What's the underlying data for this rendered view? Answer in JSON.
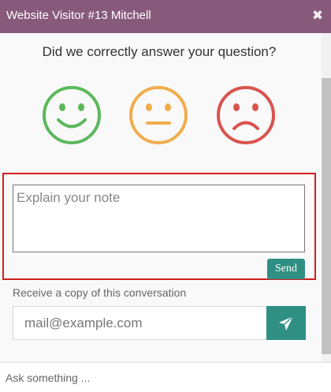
{
  "header": {
    "title": "Website Visitor #13 Mitchell",
    "close_icon": "close-icon"
  },
  "rating": {
    "question": "Did we correctly answer your question?",
    "faces": [
      {
        "name": "happy",
        "color": "#5cb85c"
      },
      {
        "name": "neutral",
        "color": "#f0ad4e"
      },
      {
        "name": "sad",
        "color": "#d9534f"
      }
    ]
  },
  "feedback": {
    "note_placeholder": "Explain your note",
    "send_label": "Send"
  },
  "transcript": {
    "label": "Receive a copy of this conversation",
    "email_placeholder": "mail@example.com",
    "send_icon": "paper-plane-icon"
  },
  "composer": {
    "placeholder": "Ask something ..."
  },
  "colors": {
    "header": "#875a7b",
    "accent": "#2f8f83",
    "highlight": "#d01f1f"
  }
}
